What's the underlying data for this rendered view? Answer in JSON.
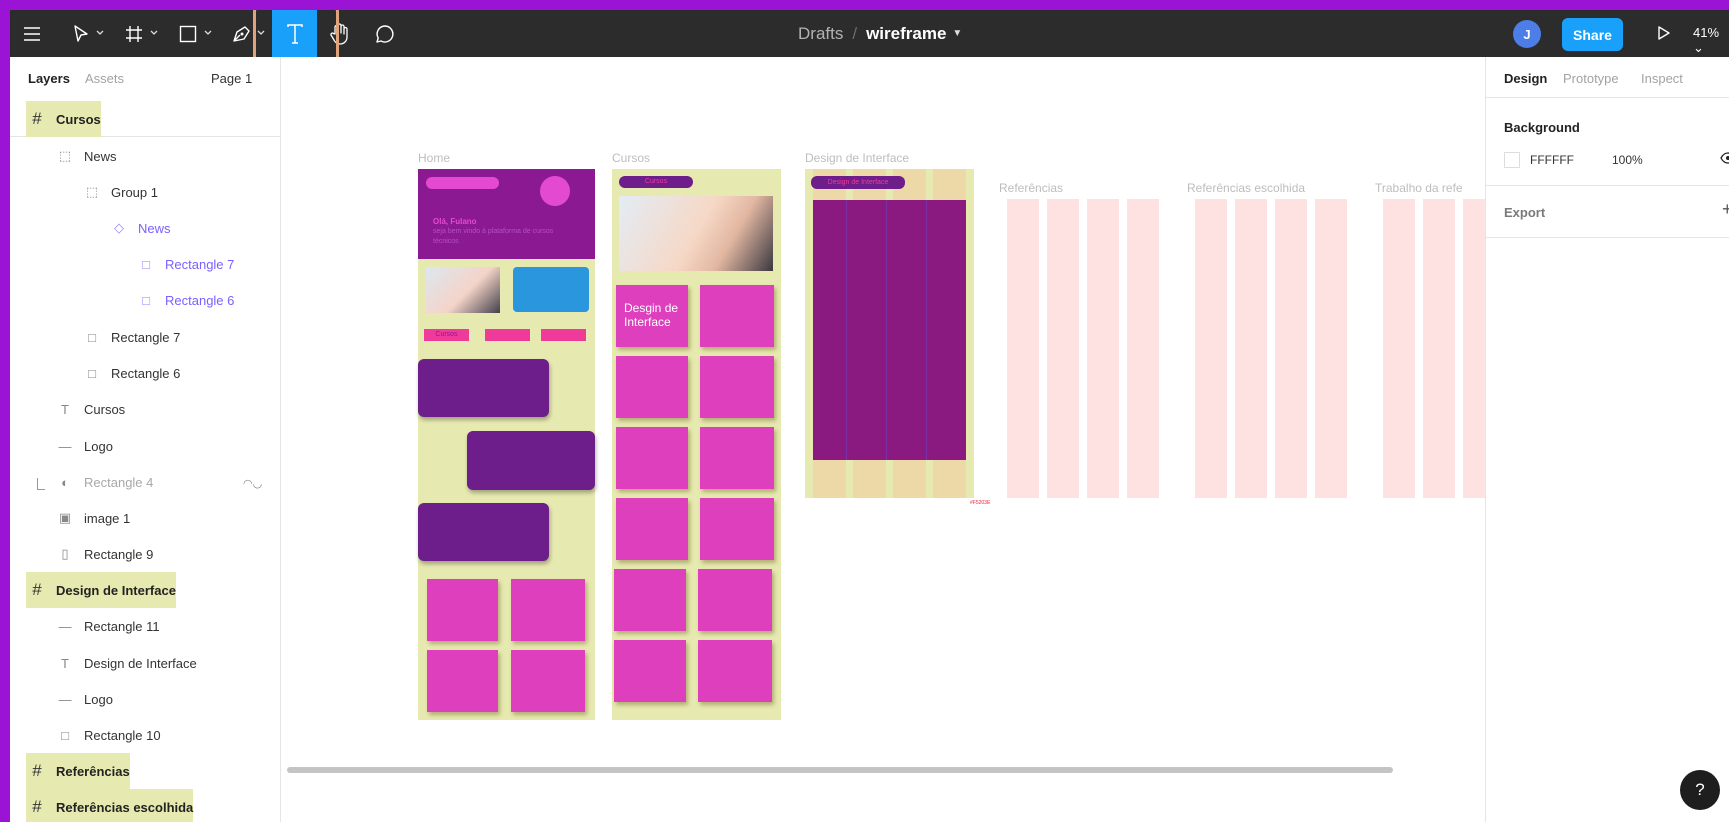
{
  "toolbar": {
    "breadcrumb_project": "Drafts",
    "breadcrumb_separator": "/",
    "file_name": "wireframe",
    "avatar_initial": "J",
    "share_label": "Share",
    "zoom": "41%",
    "active_tool": "text",
    "highlight_color": "#e0a47c"
  },
  "left_panel": {
    "tabs": [
      "Layers",
      "Assets"
    ],
    "page": "Page 1",
    "frame_cursos": "Cursos",
    "layers": [
      {
        "label": "News",
        "icon": "group-icon"
      },
      {
        "label": "Group 1",
        "icon": "group-icon"
      },
      {
        "label": "News",
        "icon": "component-icon"
      },
      {
        "label": "Rectangle 7",
        "icon": "rectangle-icon"
      },
      {
        "label": "Rectangle 6",
        "icon": "rectangle-icon"
      },
      {
        "label": "Rectangle 7",
        "icon": "rectangle-icon"
      },
      {
        "label": "Rectangle 6",
        "icon": "rectangle-icon"
      },
      {
        "label": "Cursos",
        "icon": "text-icon"
      },
      {
        "label": "Logo",
        "icon": "line-icon"
      },
      {
        "label": "Rectangle 4",
        "icon": "mask-icon"
      },
      {
        "label": "image 1",
        "icon": "image-icon"
      },
      {
        "label": "Rectangle 9",
        "icon": "rectangle-icon"
      },
      {
        "label": "Design de Interface",
        "icon": "frame-icon"
      },
      {
        "label": "Rectangle 11",
        "icon": "line-icon"
      },
      {
        "label": "Design de Interface",
        "icon": "text-icon"
      },
      {
        "label": "Logo",
        "icon": "line-icon"
      },
      {
        "label": "Rectangle 10",
        "icon": "rectangle-icon"
      },
      {
        "label": "Referências",
        "icon": "frame-icon"
      },
      {
        "label": "Referências escolhida",
        "icon": "frame-icon"
      }
    ]
  },
  "canvas": {
    "frames": [
      "Home",
      "Cursos",
      "Design de Interface",
      "Referências",
      "Referências escolhida",
      "Trabalho da refe"
    ],
    "home": {
      "greeting": "Olá, Fulano",
      "welcome": "seja bem vindo à plataforma de cursos técnicos",
      "pill_label": "Cursos"
    },
    "cursos": {
      "pill_label": "Cursos",
      "card_label": "Desgin de Interface"
    },
    "design": {
      "pill_label": "Design de Interface",
      "color_tag": "#F5203E"
    },
    "colors": {
      "frame_bg": "#e7eab0",
      "card": "#de3fbd",
      "plum": "#6e1e8a",
      "grid_col": "#fee1e1"
    }
  },
  "right_panel": {
    "tabs": [
      "Design",
      "Prototype",
      "Inspect"
    ],
    "background_title": "Background",
    "bg_hex": "FFFFFF",
    "bg_opacity": "100%",
    "export_title": "Export"
  },
  "help": "?"
}
